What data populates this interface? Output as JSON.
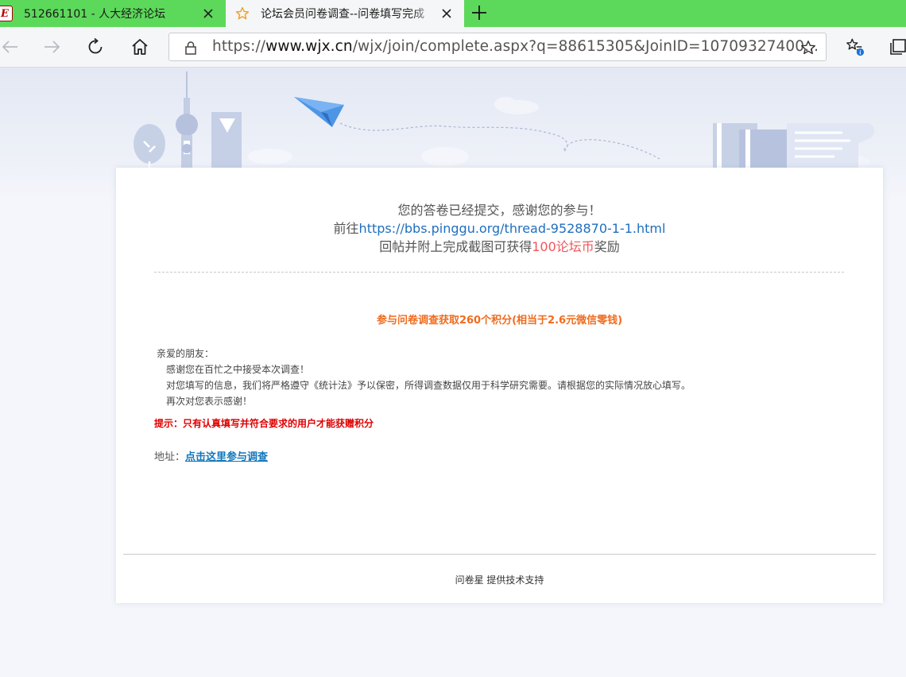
{
  "tabs": [
    {
      "favicon": "E",
      "title": "512661101 - 人大经济论坛"
    },
    {
      "favicon_icon": "star-outline-icon",
      "title": "论坛会员问卷调查--问卷填写完成"
    }
  ],
  "address_bar": {
    "protocol": "https://",
    "host": "www.wjx.cn",
    "path": "/wjx/join/complete.aspx?q=88615305&JoinID=10709327400..."
  },
  "colors": {
    "tab_strip": "#5cd95a",
    "link": "#1f6fbf",
    "highlight": "#f3555a",
    "orange": "#ef6c1e",
    "tip_red": "#e00000"
  },
  "page": {
    "thanks_line1": "您的答卷已经提交，感谢您的参与！",
    "thanks_line2_prefix": "前往",
    "thanks_link": "https://bbs.pinggu.org/thread-9528870-1-1.html",
    "thanks_line3_prefix": "回帖并附上完成截图可获得",
    "thanks_reward": "100论坛币",
    "thanks_line3_suffix": "奖励",
    "survey_title": "参与问卷调查获取260个积分(相当于2.6元微信零钱)",
    "letter": [
      "亲爱的朋友：",
      "感谢您在百忙之中接受本次调查！",
      "对您填写的信息，我们将严格遵守《统计法》予以保密，所得调查数据仅用于科学研究需要。请根据您的实际情况放心填写。",
      "再次对您表示感谢！"
    ],
    "tip": "提示：只有认真填写并符合要求的用户才能获赠积分",
    "address_label": "地址：",
    "address_link": "点击这里参与调查",
    "footer": "问卷星 提供技术支持"
  }
}
